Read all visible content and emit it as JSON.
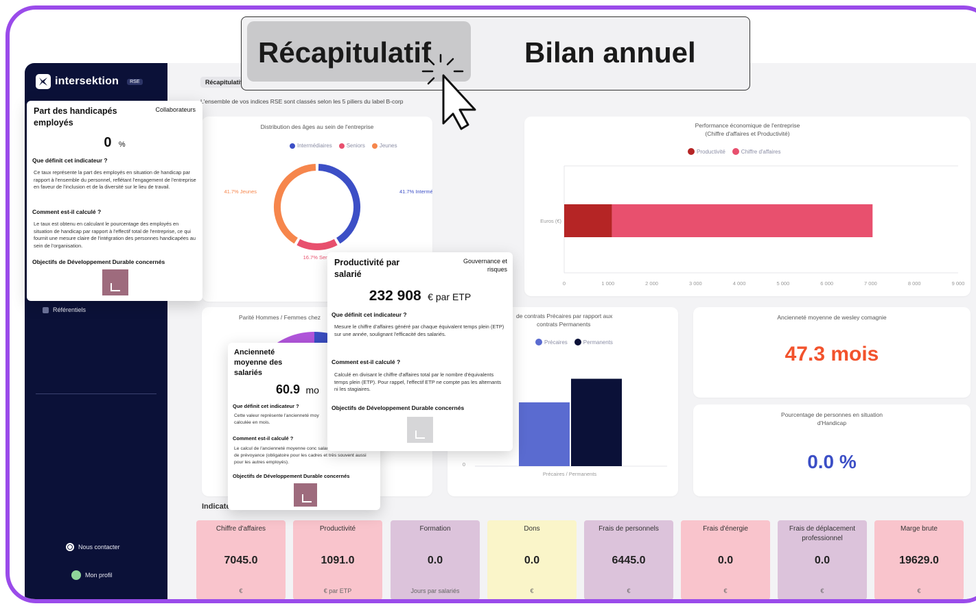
{
  "app": {
    "brand": "intersektion",
    "brand_tag": "RSE",
    "breadcrumb": "Récapitulatif",
    "subtitle": "L'ensemble de vos indices RSE sont classés selon les 5 piliers du label B-corp"
  },
  "overlay_tabs": [
    {
      "label": "Récapitulatif",
      "active": true
    },
    {
      "label": "Bilan annuel",
      "active": false
    }
  ],
  "sidebar": {
    "items": [
      {
        "label": "Référentiels"
      }
    ],
    "footer": [
      {
        "label": "Nous contacter",
        "icon": "globe-icon"
      },
      {
        "label": "Mon profil",
        "icon": "avatar-icon"
      }
    ]
  },
  "cards": {
    "ages": {
      "title": "Distribution des âges au sein de l'entreprise"
    },
    "perf": {
      "title": "Performance économique de l'entreprise",
      "subtitle": "(Chiffre d'affaires et Productivité)"
    },
    "parity": {
      "title": "Parité Hommes / Femmes chez"
    },
    "contracts": {
      "title": "de contrats Précaires par rapport aux",
      "title2": "contrats Permanents"
    },
    "seniority": {
      "title": "Ancienneté moyenne de wesley comagnie",
      "value": "47.3 mois"
    },
    "handicap": {
      "title": "Pourcentage de personnes en situation",
      "title2": "d'Handicap",
      "value": "0.0 %"
    }
  },
  "indicators_heading": "Indicateu",
  "popups": {
    "handicap": {
      "title": "Part des handicapés employés",
      "category": "Collaborateurs",
      "value": "0",
      "unit": "%",
      "q1": "Que définit cet indicateur ?",
      "a1": "Ce taux représente la part des employés en situation de handicap par rapport à l'ensemble du personnel, reflétant l'engagement de l'entreprise en faveur de l'inclusion et de la diversité sur le lieu de travail.",
      "q2": "Comment est-il calculé ?",
      "a2": "Le taux est obtenu en calculant le pourcentage des employés en situation de handicap par rapport à l'effectif total de l'entreprise, ce qui fournit une mesure claire de l'intégration des personnes handicapées au sein de l'organisation.",
      "q3": "Objectifs de Développement Durable concernés"
    },
    "productivity": {
      "title": "Productivité par salarié",
      "category": "Gouvernance et risques",
      "value": "232 908",
      "unit": "€ par ETP",
      "q1": "Que définit cet indicateur ?",
      "a1": "Mesure le chiffre d'affaires généré par chaque équivalent temps plein (ETP) sur une année, soulignant l'efficacité des salariés.",
      "q2": "Comment est-il calculé ?",
      "a2": "Calculé en divisant le chiffre d'affaires total par le nombre d'équivalents temps plein (ETP). Pour rappel, l'effectif ETP ne compte pas les alternants ni les stagiaires.",
      "q3": "Objectifs de Développement Durable concernés"
    },
    "seniority": {
      "title": "Ancienneté moyenne des salariés",
      "value": "60.9",
      "unit": "mo",
      "q1": "Que définit cet indicateur ?",
      "a1": "Cette valeur représente l'ancienneté moy calculée en mois.",
      "q2": "Comment est-il calculé ?",
      "a2": "Le calcul de l'ancienneté moyenne conc salariés affiliés à un contrat de prévoyance (obligatoire pour les cadres et très souvent aussi pour les autres employés).",
      "q3": "Objectifs de Développement Durable concernés"
    }
  },
  "kpis": [
    {
      "label": "Chiffre d'affaires",
      "value": "7045.0",
      "unit": "€",
      "color": "#f9c4cc"
    },
    {
      "label": "Productivité",
      "value": "1091.0",
      "unit": "€ par ETP",
      "color": "#f9c4cc"
    },
    {
      "label": "Formation",
      "value": "0.0",
      "unit": "Jours par salariés",
      "color": "#dcc3db"
    },
    {
      "label": "Dons",
      "value": "0.0",
      "unit": "€",
      "color": "#faf5c9"
    },
    {
      "label": "Frais de personnels",
      "value": "6445.0",
      "unit": "€",
      "color": "#dcc3db"
    },
    {
      "label": "Frais d'énergie",
      "value": "0.0",
      "unit": "€",
      "color": "#f9c4cc"
    },
    {
      "label": "Frais de déplacement professionnel",
      "value": "0.0",
      "unit": "€",
      "color": "#dcc3db"
    },
    {
      "label": "Marge brute",
      "value": "19629.0",
      "unit": "€",
      "color": "#f9c4cc"
    }
  ],
  "colors": {
    "sidebar": "#0b1138",
    "frame": "#9a4bea",
    "blue": "#3c4fc6",
    "pink": "#e8506e",
    "orange": "#f6864c",
    "darkred": "#b52525",
    "navy": "#0b1138",
    "seniority_value": "#f2532d",
    "handicap_value": "#3c4fc6"
  },
  "chart_data": [
    {
      "type": "pie",
      "title": "Distribution des âges au sein de l'entreprise",
      "labels": [
        "Intermédiaires",
        "Seniors",
        "Jeunes"
      ],
      "values": [
        41.7,
        16.7,
        41.7
      ],
      "data_labels": [
        "41.7% Intermédiaires",
        "16.7% Seniors",
        "41.7% Jeunes"
      ],
      "colors": [
        "#3c4fc6",
        "#e8506e",
        "#f6864c"
      ],
      "legend": "top"
    },
    {
      "type": "bar",
      "orientation": "horizontal",
      "stacked": true,
      "title": "Performance économique de l'entreprise",
      "subtitle": "(Chiffre d'affaires et Productivité)",
      "categories": [
        "Euros (€)"
      ],
      "series": [
        {
          "name": "Productivité",
          "values": [
            1091
          ],
          "color": "#b52525"
        },
        {
          "name": "Chiffre d'affaires",
          "values": [
            7045
          ],
          "color": "#e8506e"
        }
      ],
      "xlim": [
        0,
        9000
      ],
      "xticks": [
        "0",
        "1 000",
        "2 000",
        "3 000",
        "4 000",
        "5 000",
        "6 000",
        "7 000",
        "8 000",
        "9 000"
      ],
      "legend": "top"
    },
    {
      "type": "bar",
      "title": "de contrats Précaires par rapport aux contrats Permanents",
      "categories": [
        "Précaires / Permanents"
      ],
      "series": [
        {
          "name": "Précaires",
          "values": [
            4.6
          ],
          "color": "#5a6bd0"
        },
        {
          "name": "Permanents",
          "values": [
            6.3
          ],
          "color": "#0b1138"
        }
      ],
      "ylim": [
        0,
        8.5
      ],
      "yticks": [
        "0"
      ],
      "legend": "top"
    }
  ]
}
